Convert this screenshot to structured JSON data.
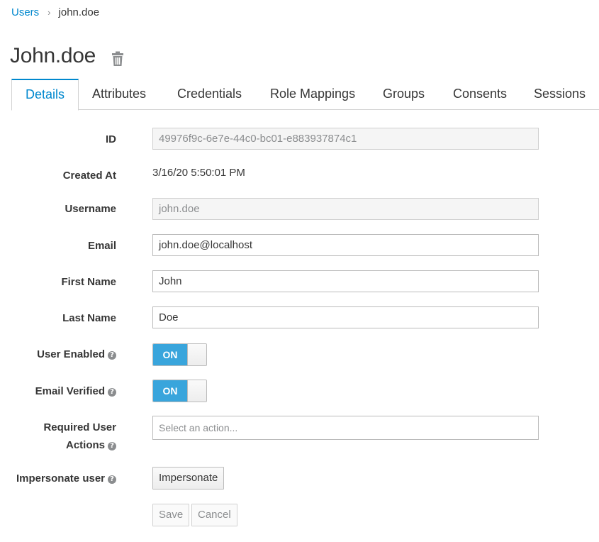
{
  "breadcrumb": {
    "parent": "Users",
    "separator": "›",
    "current": "john.doe"
  },
  "page_title": "John.doe",
  "tabs": [
    "Details",
    "Attributes",
    "Credentials",
    "Role Mappings",
    "Groups",
    "Consents",
    "Sessions"
  ],
  "form": {
    "id_label": "ID",
    "id_value": "49976f9c-6e7e-44c0-bc01-e883937874c1",
    "created_label": "Created At",
    "created_value": "3/16/20 5:50:01 PM",
    "username_label": "Username",
    "username_value": "john.doe",
    "email_label": "Email",
    "email_value": "john.doe@localhost",
    "first_name_label": "First Name",
    "first_name_value": "John",
    "last_name_label": "Last Name",
    "last_name_value": "Doe",
    "user_enabled_label": "User Enabled",
    "user_enabled_state": "ON",
    "email_verified_label": "Email Verified",
    "email_verified_state": "ON",
    "required_actions_label_1": "Required User",
    "required_actions_label_2": "Actions",
    "required_actions_placeholder": "Select an action...",
    "impersonate_label": "Impersonate user",
    "impersonate_button": "Impersonate",
    "help_icon": "?"
  },
  "actions": {
    "save": "Save",
    "cancel": "Cancel"
  },
  "colors": {
    "accent": "#0088ce",
    "toggle_on": "#39a5dc"
  },
  "icons": {
    "delete": "trash-icon",
    "help": "question-circle-icon"
  }
}
